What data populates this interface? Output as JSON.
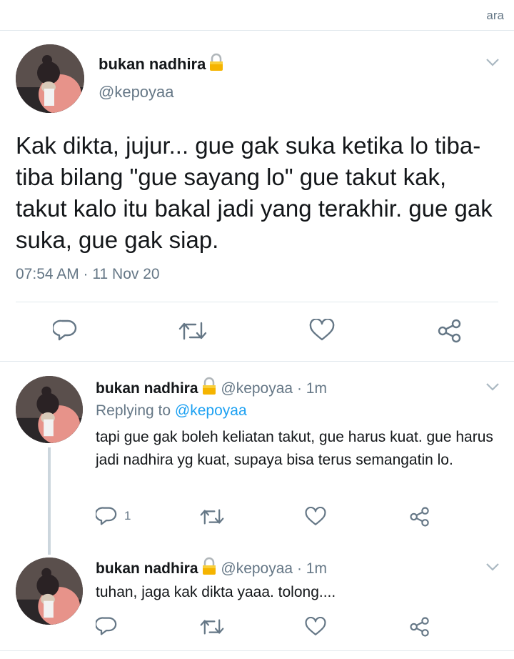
{
  "top_label": "ara",
  "main_tweet": {
    "display_name": "bukan nadhira",
    "handle": "@kepoyaa",
    "text": "Kak dikta, jujur... gue gak suka ketika lo tiba-tiba bilang \"gue sayang lo\" gue takut kak, takut kalo itu bakal jadi yang terakhir. gue gak suka, gue gak siap.",
    "timestamp": "07:54 AM · 11 Nov 20"
  },
  "replies": [
    {
      "display_name": "bukan nadhira",
      "handle": "@kepoyaa",
      "time": "· 1m",
      "replying_prefix": "Replying to ",
      "replying_to": "@kepoyaa",
      "text": "tapi gue gak boleh keliatan takut, gue harus kuat. gue harus jadi nadhira yg kuat, supaya bisa terus semangatin lo.",
      "reply_count": "1"
    },
    {
      "display_name": "bukan nadhira",
      "handle": "@kepoyaa",
      "time": "· 1m",
      "text": "tuhan, jaga kak dikta yaaa. tolong...."
    }
  ],
  "icons": {
    "lock": "lock-icon",
    "chevron": "chevron-down-icon",
    "reply": "reply-icon",
    "retweet": "retweet-icon",
    "like": "heart-icon",
    "share": "share-icon"
  },
  "colors": {
    "text": "#14171a",
    "secondary": "#657786",
    "link": "#1da1f2",
    "divider": "#e1e8ed",
    "lock": "#f5b400"
  }
}
